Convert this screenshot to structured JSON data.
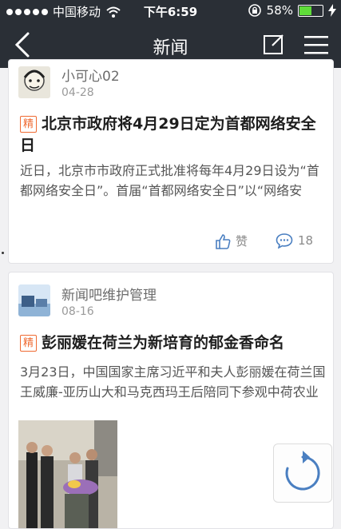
{
  "status_bar": {
    "carrier": "中国移动",
    "time": "下午6:59",
    "battery": "58%",
    "battery_level": 0.58,
    "signal_icon": "signal-dots-icon",
    "wifi_icon": "wifi-icon",
    "lock_icon": "rotation-lock-icon",
    "charging_icon": "bolt-icon"
  },
  "nav": {
    "title": "新闻",
    "back_icon": "back-chevron-icon",
    "compose_icon": "compose-icon",
    "menu_icon": "menu-icon"
  },
  "posts": [
    {
      "author": "小可心02",
      "date": "04-28",
      "badge": "精",
      "title": "北京市政府将4月29日定为首都网络安全日",
      "excerpt": "近日，北京市市政府正式批准将每年4月29日设为“首都网络安全日”。首届“首都网络安全日”以“网络安",
      "like_label": "赞",
      "comment_count": "18"
    },
    {
      "author": "新闻吧维护管理",
      "date": "08-16",
      "badge": "精",
      "title": "彭丽媛在荷兰为新培育的郁金香命名",
      "excerpt": "3月23日，中国国家主席习近平和夫人彭丽媛在荷兰国王威廉-亚历山大和马克西玛王后陪同下参观中荷农业"
    }
  ],
  "colors": {
    "bar": "#2a2f36",
    "badge": "#ef6a32",
    "icon_blue": "#4a7fc1",
    "background": "#f1f1f3"
  },
  "refresh_icon": "refresh-icon"
}
